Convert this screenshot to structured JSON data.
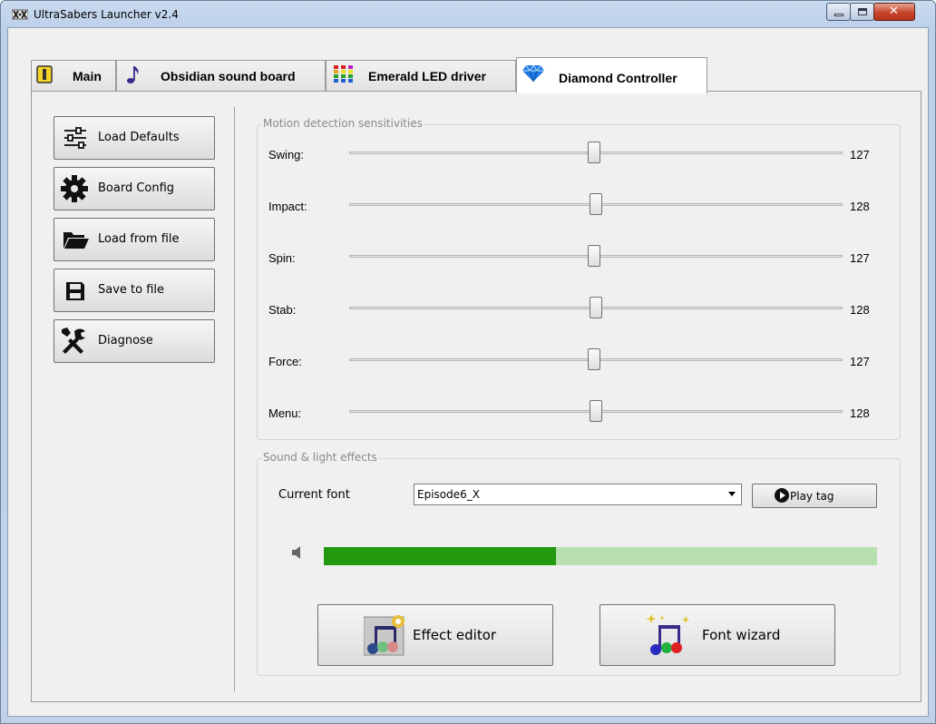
{
  "window": {
    "title": "UltraSabers Launcher v2.4",
    "icons": {
      "app": "ultrasabers-logo-icon",
      "minimize": "minimize-icon",
      "maximize": "maximize-icon",
      "close": "close-icon"
    }
  },
  "tabs": [
    {
      "label": "Main",
      "icon": "main-tab-icon",
      "active": false
    },
    {
      "label": "Obsidian sound board",
      "icon": "music-note-icon",
      "active": false
    },
    {
      "label": "Emerald LED driver",
      "icon": "led-bars-icon",
      "active": false
    },
    {
      "label": "Diamond Controller",
      "icon": "diamond-icon",
      "active": true
    }
  ],
  "sidebar": {
    "buttons": [
      {
        "label": "Load Defaults",
        "icon": "sliders-icon"
      },
      {
        "label": "Board Config",
        "icon": "gear-icon"
      },
      {
        "label": "Load from file",
        "icon": "folder-open-icon"
      },
      {
        "label": "Save to file",
        "icon": "floppy-disk-icon"
      },
      {
        "label": "Diagnose",
        "icon": "tools-icon"
      }
    ]
  },
  "motion": {
    "title": "Motion detection sensitivities",
    "sliders": [
      {
        "label": "Swing:",
        "value": "127"
      },
      {
        "label": "Impact:",
        "value": "128"
      },
      {
        "label": "Spin:",
        "value": "127"
      },
      {
        "label": "Stab:",
        "value": "128"
      },
      {
        "label": "Force:",
        "value": "127"
      },
      {
        "label": "Menu:",
        "value": "128"
      }
    ]
  },
  "effects": {
    "title": "Sound & light effects",
    "font_label": "Current font",
    "font_value": "Episode6_X",
    "play_label": "Play tag",
    "volume_fraction": 0.42,
    "colors": {
      "volume_fill": "#22990f",
      "volume_track": "#b8dfb0"
    },
    "effect_editor_label": "Effect editor",
    "font_wizard_label": "Font wizard"
  }
}
